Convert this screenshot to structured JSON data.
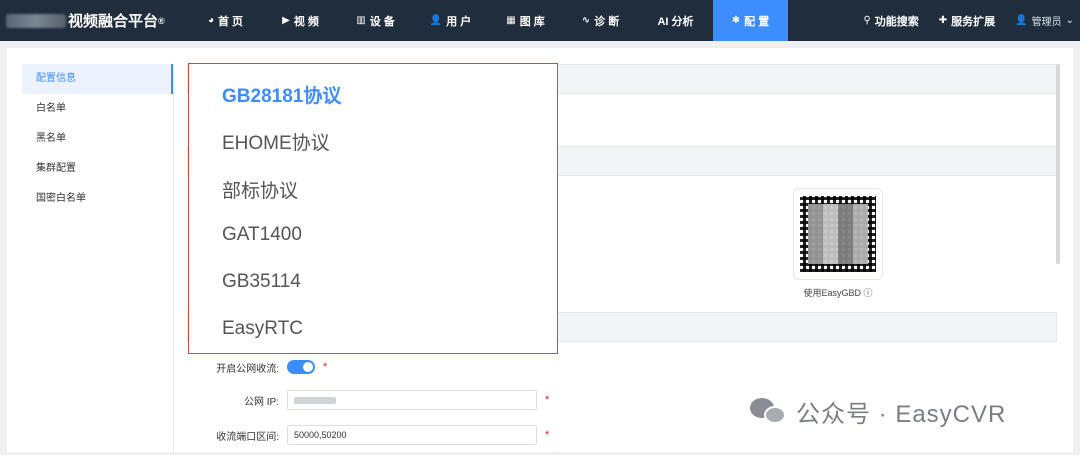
{
  "header": {
    "brand_suffix": "视频融合平台",
    "brand_mark": "®",
    "nav": [
      {
        "icon": "dashboard-icon",
        "glyph": "◕",
        "label": "首 页"
      },
      {
        "icon": "play-circle-icon",
        "glyph": "▶",
        "label": "视 频"
      },
      {
        "icon": "device-grid-icon",
        "glyph": "▥",
        "label": "设 备"
      },
      {
        "icon": "user-icon",
        "glyph": "👤",
        "label": "用 户"
      },
      {
        "icon": "library-icon",
        "glyph": "▦",
        "label": "图 库"
      },
      {
        "icon": "pulse-icon",
        "glyph": "∿",
        "label": "诊 断"
      },
      {
        "icon": "",
        "glyph": "",
        "label": "AI 分析"
      },
      {
        "icon": "gear-icon",
        "glyph": "✱",
        "label": "配 置"
      }
    ],
    "active_nav_index": 7,
    "search_label": "功能搜索",
    "extension_label": "服务扩展",
    "user_label": "管理员"
  },
  "sidebar": {
    "items": [
      "配置信息",
      "白名单",
      "黑名单",
      "集群配置",
      "国密白名单"
    ],
    "active_index": 0
  },
  "qr": {
    "caption": "使用EasyGBD"
  },
  "form": {
    "public_stream_label": "开启公网收流:",
    "public_stream_enabled": true,
    "public_ip_label": "公网 IP:",
    "port_range_label": "收流端口区间:",
    "port_range_value": "50000,50200",
    "required_mark": "*"
  },
  "dropdown": {
    "options": [
      "GB28181协议",
      "EHOME协议",
      "部标协议",
      "GAT1400",
      "GB35114",
      "EasyRTC"
    ],
    "selected_index": 0
  },
  "watermark": {
    "text": "公众号 · EasyCVR"
  },
  "colors": {
    "topbar": "#1f2d3d",
    "accent": "#3c8dff",
    "highlight_border": "#d9453f",
    "required": "#e02020"
  }
}
